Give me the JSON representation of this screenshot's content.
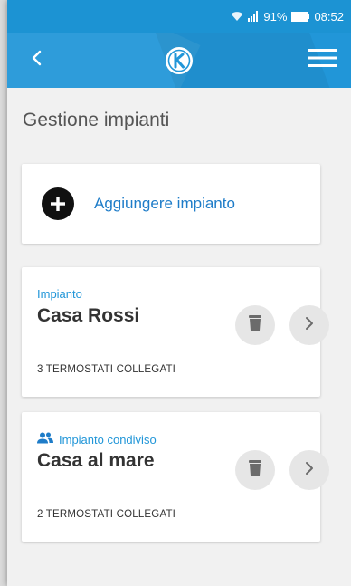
{
  "statusbar": {
    "battery": "91%",
    "time": "08:52",
    "icons": [
      "wifi-icon",
      "signal-icon",
      "battery-icon"
    ]
  },
  "appbar": {
    "back_icon": "chevron-left-icon",
    "logo_icon": "brand-logo-icon",
    "menu_icon": "hamburger-menu-icon"
  },
  "page": {
    "title": "Gestione impianti"
  },
  "add_card": {
    "label": "Aggiungere impianto",
    "icon": "plus-circle-icon"
  },
  "plants": [
    {
      "kind": "Impianto",
      "name": "Casa Rossi",
      "count": "3 TERMOSTATI COLLEGATI",
      "shared": false
    },
    {
      "kind": "Impianto condiviso",
      "name": "Casa al mare",
      "count": "2 TERMOSTATI COLLEGATI",
      "shared": true
    }
  ],
  "colors": {
    "primary": "#2196d8",
    "link": "#1e7cc8",
    "background": "#f1f1f1",
    "card": "#ffffff",
    "button_bg": "#e6e6e6"
  }
}
